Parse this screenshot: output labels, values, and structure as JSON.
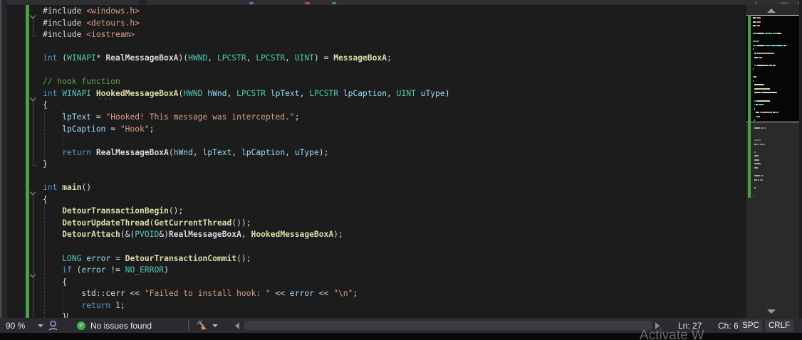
{
  "colors": {
    "tokens": {
      "kw": "#569cd6",
      "type": "#4ec9b0",
      "fn": "#dcdcaa",
      "glob": "#d8d8d8",
      "var": "#9cdcfe",
      "str": "#d69d85",
      "com": "#57a64a",
      "num": "#b5cea8",
      "plain": "#dcdcdc"
    },
    "change_bar_green": "#45a545",
    "health_green": "#3fae4f",
    "editor_background": "#1c1c1c",
    "status_bar_background": "#2b2b2f"
  },
  "icons": {
    "health_check_glyph": "✓",
    "fold_chevron": "chevron-down",
    "code_cleanup": "broom",
    "intellicode": "head-silhouette"
  },
  "editor": {
    "code_lines": [
      {
        "fold": true,
        "tokens": [
          [
            "plain",
            "#include "
          ],
          [
            "str",
            "<windows.h>"
          ]
        ]
      },
      {
        "fold": false,
        "tokens": [
          [
            "plain",
            "#include "
          ],
          [
            "str",
            "<detours.h>"
          ]
        ]
      },
      {
        "fold": false,
        "tokens": [
          [
            "plain",
            "#include "
          ],
          [
            "str",
            "<iostream>"
          ]
        ]
      },
      {
        "fold": false,
        "tokens": []
      },
      {
        "fold": false,
        "tokens": [
          [
            "kw",
            "int"
          ],
          [
            "plain",
            " ("
          ],
          [
            "type",
            "WINAPI"
          ],
          [
            "plain",
            "* "
          ],
          [
            "glob",
            "RealMessageBoxA"
          ],
          [
            "plain",
            ")("
          ],
          [
            "type",
            "HWND"
          ],
          [
            "plain",
            ", "
          ],
          [
            "type",
            "LPCSTR"
          ],
          [
            "plain",
            ", "
          ],
          [
            "type",
            "LPCSTR"
          ],
          [
            "plain",
            ", "
          ],
          [
            "type",
            "UINT"
          ],
          [
            "plain",
            ") = "
          ],
          [
            "fn",
            "MessageBoxA"
          ],
          [
            "plain",
            ";"
          ]
        ]
      },
      {
        "fold": false,
        "tokens": []
      },
      {
        "fold": false,
        "tokens": [
          [
            "com",
            "// hook function"
          ]
        ]
      },
      {
        "fold": true,
        "tokens": [
          [
            "kw",
            "int"
          ],
          [
            "plain",
            " "
          ],
          [
            "type",
            "WINAPI"
          ],
          [
            "plain",
            " "
          ],
          [
            "fn",
            "HookedMessageBoxA"
          ],
          [
            "plain",
            "("
          ],
          [
            "type",
            "HWND"
          ],
          [
            "plain",
            " "
          ],
          [
            "var",
            "hWnd"
          ],
          [
            "plain",
            ", "
          ],
          [
            "type",
            "LPCSTR"
          ],
          [
            "plain",
            " "
          ],
          [
            "var",
            "lpText"
          ],
          [
            "plain",
            ", "
          ],
          [
            "type",
            "LPCSTR"
          ],
          [
            "plain",
            " "
          ],
          [
            "var",
            "lpCaption"
          ],
          [
            "plain",
            ", "
          ],
          [
            "type",
            "UINT"
          ],
          [
            "plain",
            " "
          ],
          [
            "var",
            "uType"
          ],
          [
            "plain",
            ")"
          ]
        ]
      },
      {
        "fold": false,
        "tokens": [
          [
            "plain",
            "{"
          ]
        ]
      },
      {
        "fold": false,
        "tokens": [
          [
            "plain",
            "    "
          ],
          [
            "var",
            "lpText"
          ],
          [
            "plain",
            " = "
          ],
          [
            "str",
            "\"Hooked! This message was intercepted.\""
          ],
          [
            "plain",
            ";"
          ]
        ]
      },
      {
        "fold": false,
        "tokens": [
          [
            "plain",
            "    "
          ],
          [
            "var",
            "lpCaption"
          ],
          [
            "plain",
            " = "
          ],
          [
            "str",
            "\"Hook\""
          ],
          [
            "plain",
            ";"
          ]
        ]
      },
      {
        "fold": false,
        "tokens": []
      },
      {
        "fold": false,
        "tokens": [
          [
            "plain",
            "    "
          ],
          [
            "kw",
            "return"
          ],
          [
            "plain",
            " "
          ],
          [
            "glob",
            "RealMessageBoxA"
          ],
          [
            "plain",
            "("
          ],
          [
            "var",
            "hWnd"
          ],
          [
            "plain",
            ", "
          ],
          [
            "var",
            "lpText"
          ],
          [
            "plain",
            ", "
          ],
          [
            "var",
            "lpCaption"
          ],
          [
            "plain",
            ", "
          ],
          [
            "var",
            "uType"
          ],
          [
            "plain",
            ");"
          ]
        ]
      },
      {
        "fold": false,
        "tokens": [
          [
            "plain",
            "}"
          ]
        ]
      },
      {
        "fold": false,
        "tokens": []
      },
      {
        "fold": true,
        "tokens": [
          [
            "kw",
            "int"
          ],
          [
            "plain",
            " "
          ],
          [
            "fn",
            "main"
          ],
          [
            "plain",
            "()"
          ]
        ]
      },
      {
        "fold": false,
        "tokens": [
          [
            "plain",
            "{"
          ]
        ]
      },
      {
        "fold": false,
        "tokens": [
          [
            "plain",
            "    "
          ],
          [
            "fn",
            "DetourTransactionBegin"
          ],
          [
            "plain",
            "();"
          ]
        ]
      },
      {
        "fold": false,
        "tokens": [
          [
            "plain",
            "    "
          ],
          [
            "fn",
            "DetourUpdateThread"
          ],
          [
            "plain",
            "("
          ],
          [
            "fn",
            "GetCurrentThread"
          ],
          [
            "plain",
            "());"
          ]
        ]
      },
      {
        "fold": false,
        "tokens": [
          [
            "plain",
            "    "
          ],
          [
            "fn",
            "DetourAttach"
          ],
          [
            "plain",
            "(&("
          ],
          [
            "type",
            "PVOID"
          ],
          [
            "plain",
            "&)"
          ],
          [
            "glob",
            "RealMessageBoxA"
          ],
          [
            "plain",
            ", "
          ],
          [
            "fn",
            "HookedMessageBoxA"
          ],
          [
            "plain",
            ");"
          ]
        ]
      },
      {
        "fold": false,
        "tokens": []
      },
      {
        "fold": false,
        "tokens": [
          [
            "plain",
            "    "
          ],
          [
            "type",
            "LONG"
          ],
          [
            "plain",
            " "
          ],
          [
            "var",
            "error"
          ],
          [
            "plain",
            " = "
          ],
          [
            "fn",
            "DetourTransactionCommit"
          ],
          [
            "plain",
            "();"
          ]
        ]
      },
      {
        "fold": true,
        "tokens": [
          [
            "plain",
            "    "
          ],
          [
            "kw",
            "if"
          ],
          [
            "plain",
            " ("
          ],
          [
            "var",
            "error"
          ],
          [
            "plain",
            " != "
          ],
          [
            "type",
            "NO_ERROR"
          ],
          [
            "plain",
            ")"
          ]
        ]
      },
      {
        "fold": false,
        "tokens": [
          [
            "plain",
            "    {"
          ]
        ]
      },
      {
        "fold": false,
        "tokens": [
          [
            "plain",
            "        std::cerr "
          ],
          [
            "plain",
            "<< "
          ],
          [
            "str",
            "\"Failed to install hook: \""
          ],
          [
            "plain",
            " << "
          ],
          [
            "var",
            "error"
          ],
          [
            "plain",
            " << "
          ],
          [
            "str",
            "\"\\n\""
          ],
          [
            "plain",
            ";"
          ]
        ]
      },
      {
        "fold": false,
        "tokens": [
          [
            "plain",
            "        "
          ],
          [
            "kw",
            "return"
          ],
          [
            "plain",
            " "
          ],
          [
            "num",
            "1"
          ],
          [
            "plain",
            ";"
          ]
        ]
      },
      {
        "fold": false,
        "tokens": [
          [
            "plain",
            "    }"
          ]
        ]
      }
    ]
  },
  "minimap_extra": [
    {
      "n": 29,
      "ind": 4,
      "seg": [
        [
          "plain",
          14
        ],
        [
          "str",
          9
        ],
        [
          "plain",
          3
        ]
      ]
    },
    {
      "n": 32,
      "ind": 4,
      "seg": [
        [
          "com",
          16
        ]
      ]
    },
    {
      "n": 33,
      "ind": 4,
      "seg": [
        [
          "plain",
          7
        ],
        [
          "var",
          4
        ],
        [
          "str",
          8
        ],
        [
          "plain",
          2
        ]
      ]
    },
    {
      "n": 35,
      "ind": 4,
      "seg": [
        [
          "type",
          4
        ]
      ]
    },
    {
      "n": 36,
      "ind": 4,
      "seg": [
        [
          "plain",
          10
        ]
      ]
    },
    {
      "n": 37,
      "ind": 4,
      "seg": [
        [
          "plain",
          13
        ]
      ]
    },
    {
      "n": 38,
      "ind": 4,
      "seg": [
        [
          "plain",
          16
        ]
      ]
    },
    {
      "n": 39,
      "ind": 4,
      "seg": [
        [
          "plain",
          9
        ]
      ]
    },
    {
      "n": 41,
      "ind": 4,
      "seg": [
        [
          "plain",
          15
        ],
        [
          "str",
          6
        ]
      ]
    },
    {
      "n": 42,
      "ind": 4,
      "seg": [
        [
          "plain",
          7
        ],
        [
          "var",
          4
        ],
        [
          "str",
          7
        ]
      ]
    },
    {
      "n": 44,
      "ind": 4,
      "seg": [
        [
          "plain",
          3
        ]
      ]
    },
    {
      "n": 46,
      "ind": 0,
      "seg": [
        [
          "plain",
          1
        ]
      ]
    }
  ],
  "status_bar": {
    "zoom_level": "90 %",
    "health_text": "No issues found",
    "line_label": "Ln: 27",
    "column_label": "Ch: 6",
    "spaces_label": "SPC",
    "line_ending_label": "CRLF"
  },
  "watermark_text": "Activate W"
}
